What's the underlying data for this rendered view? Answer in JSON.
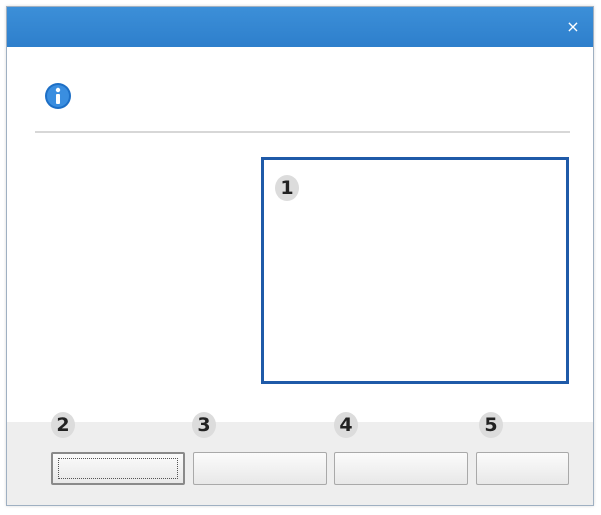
{
  "window": {
    "title": "",
    "close_glyph": "×",
    "titlebar_color": "#3482d0"
  },
  "message": {
    "icon": "info-icon",
    "text": ""
  },
  "callouts": {
    "content_area": "1",
    "button_1": "2",
    "button_2": "3",
    "button_3": "4",
    "button_4": "5"
  },
  "buttons": [
    {
      "label": "",
      "focused": true
    },
    {
      "label": ""
    },
    {
      "label": ""
    },
    {
      "label": ""
    }
  ],
  "accent_color": "#1f5aa8"
}
